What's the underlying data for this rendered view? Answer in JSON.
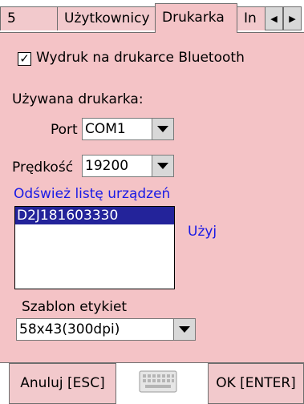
{
  "tabs": {
    "items": [
      "5",
      "Użytkownicy",
      "Drukarka",
      "In"
    ],
    "active": "Drukarka"
  },
  "bluetooth": {
    "label": "Wydruk na drukarce Bluetooth",
    "checked": true,
    "mark": "✓"
  },
  "printer_section": {
    "label": "Używana drukarka:"
  },
  "port": {
    "label": "Port",
    "value": "COM1"
  },
  "speed": {
    "label": "Prędkość",
    "value": "19200"
  },
  "refresh_link": "Odśwież listę urządzeń",
  "devices": [
    "D2J181603330"
  ],
  "use_link": "Użyj",
  "template": {
    "label": "Szablon etykiet",
    "value": "58x43(300dpi)"
  },
  "bottom": {
    "cancel": "Anuluj [ESC]",
    "ok": "OK [ENTER]"
  },
  "icons": {
    "left": "◀",
    "right": "▶"
  },
  "colors": {
    "panel": "#f4c3c6",
    "selection": "#23239a",
    "link": "#1a1ae6"
  }
}
